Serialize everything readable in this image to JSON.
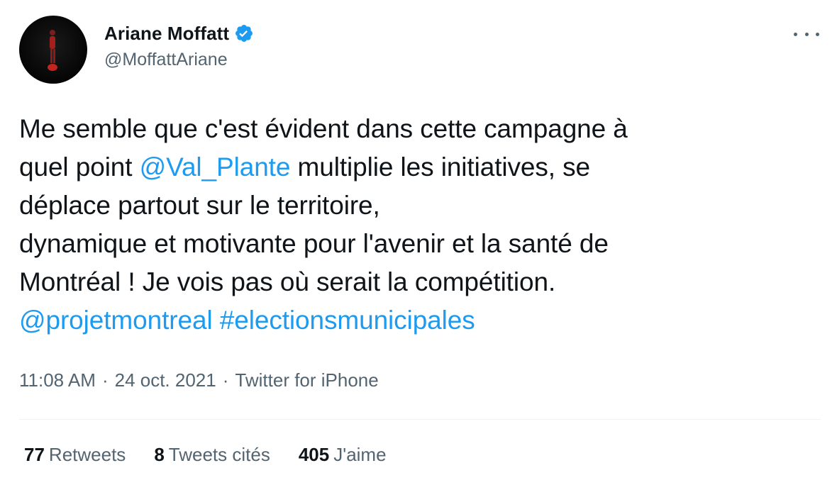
{
  "author": {
    "display_name": "Ariane Moffatt",
    "handle": "@MoffattAriane",
    "verified": true
  },
  "tweet": {
    "lines": [
      [
        {
          "text": "Me semble que c'est évident dans cette campagne à"
        }
      ],
      [
        {
          "text": "quel point "
        },
        {
          "link": "@Val_Plante"
        },
        {
          "text": " multiplie les initiatives, se"
        }
      ],
      [
        {
          "text": "déplace partout sur le territoire,"
        }
      ],
      [
        {
          "text": "dynamique et motivante pour l'avenir et la santé de"
        }
      ],
      [
        {
          "text": "Montréal ! Je vois pas où serait la compétition."
        }
      ],
      [
        {
          "link": "@projetmontreal"
        },
        {
          "text": " "
        },
        {
          "link": "#electionsmunicipales"
        }
      ]
    ]
  },
  "meta": {
    "time": "11:08 AM",
    "date": "24 oct. 2021",
    "source": "Twitter for iPhone",
    "separator": "·"
  },
  "stats": {
    "retweets": {
      "count": "77",
      "label": "Retweets"
    },
    "quotes": {
      "count": "8",
      "label": "Tweets cités"
    },
    "likes": {
      "count": "405",
      "label": "J'aime"
    }
  },
  "colors": {
    "link": "#1d9bf0",
    "secondary_text": "#536471",
    "primary_text": "#0f1419",
    "verified_badge": "#1d9bf0",
    "divider": "#eff3f4"
  },
  "icons": {
    "verified": "verified-badge-icon",
    "more": "more-options-icon"
  }
}
